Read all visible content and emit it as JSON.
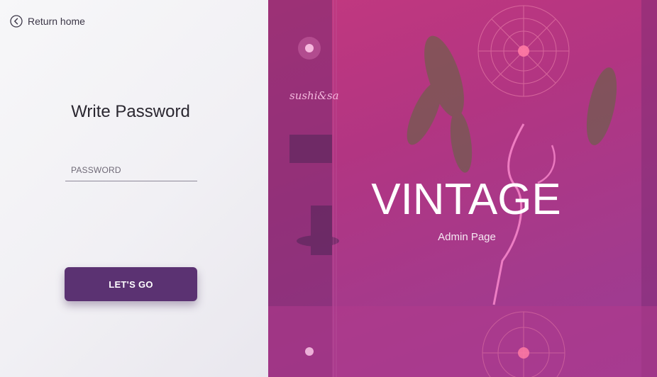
{
  "nav": {
    "return_label": "Return home"
  },
  "form": {
    "title": "Write Password",
    "password_placeholder": "PASSWORD",
    "submit_label": "LET'S GO"
  },
  "hero": {
    "brand": "VINTAGE",
    "subtitle": "Admin Page",
    "neon_sign_text": "sushi&sa"
  },
  "colors": {
    "button": "#5b3272",
    "hero_overlay": "#b23582"
  }
}
